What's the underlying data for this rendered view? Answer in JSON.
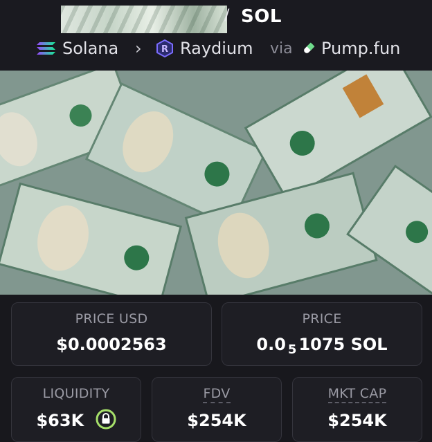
{
  "pair": {
    "quote": "SOL",
    "separator": "/"
  },
  "route": {
    "chain": "Solana",
    "arrow": "›",
    "dex": "Raydium",
    "via": "via",
    "launchpad": "Pump.fun",
    "icons": [
      "solana-icon",
      "raydium-icon",
      "pill-icon"
    ]
  },
  "stats": {
    "price_usd": {
      "label": "PRICE USD",
      "value": "$0.0002563"
    },
    "price": {
      "label": "PRICE",
      "prefix": "0.0",
      "sub": "5",
      "suffix": "1075 SOL"
    },
    "liquidity": {
      "label": "LIQUIDITY",
      "value": "$63K"
    },
    "fdv": {
      "label": "FDV",
      "value": "$254K"
    },
    "mkt_cap": {
      "label": "MKT CAP",
      "value": "$254K"
    }
  },
  "colors": {
    "background": "#18181d",
    "card": "#1e1e24",
    "lock_accent": "#a6e06a",
    "banner_note": "#c3d6c8"
  }
}
